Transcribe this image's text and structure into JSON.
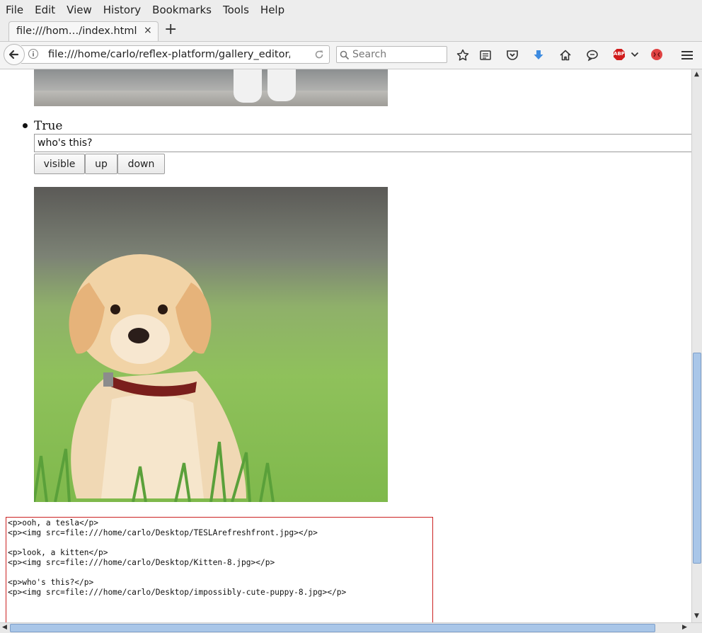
{
  "menubar": {
    "items": [
      "File",
      "Edit",
      "View",
      "History",
      "Bookmarks",
      "Tools",
      "Help"
    ]
  },
  "tab": {
    "title": "file:///hom…/index.html",
    "close": "×",
    "new_tab": "+"
  },
  "navbar": {
    "url": "file:///home/carlo/reflex-platform/gallery_editor/g",
    "search_placeholder": "Search",
    "adblock_label": "ABP"
  },
  "content": {
    "item_title": "True",
    "caption_value": "who's this?",
    "buttons": {
      "visible": "visible",
      "up": "up",
      "down": "down"
    },
    "html_output": "<p>ooh, a tesla</p>\n<p><img src=file:///home/carlo/Desktop/TESLArefreshfront.jpg></p>\n\n<p>look, a kitten</p>\n<p><img src=file:///home/carlo/Desktop/Kitten-8.jpg></p>\n\n<p>who's this?</p>\n<p><img src=file:///home/carlo/Desktop/impossibly-cute-puppy-8.jpg></p>"
  },
  "colors": {
    "accent_blue": "#3d8be0",
    "scroll_thumb": "#a9c6e8",
    "output_border": "#cc2222",
    "adblock_red": "#d01c1c"
  }
}
